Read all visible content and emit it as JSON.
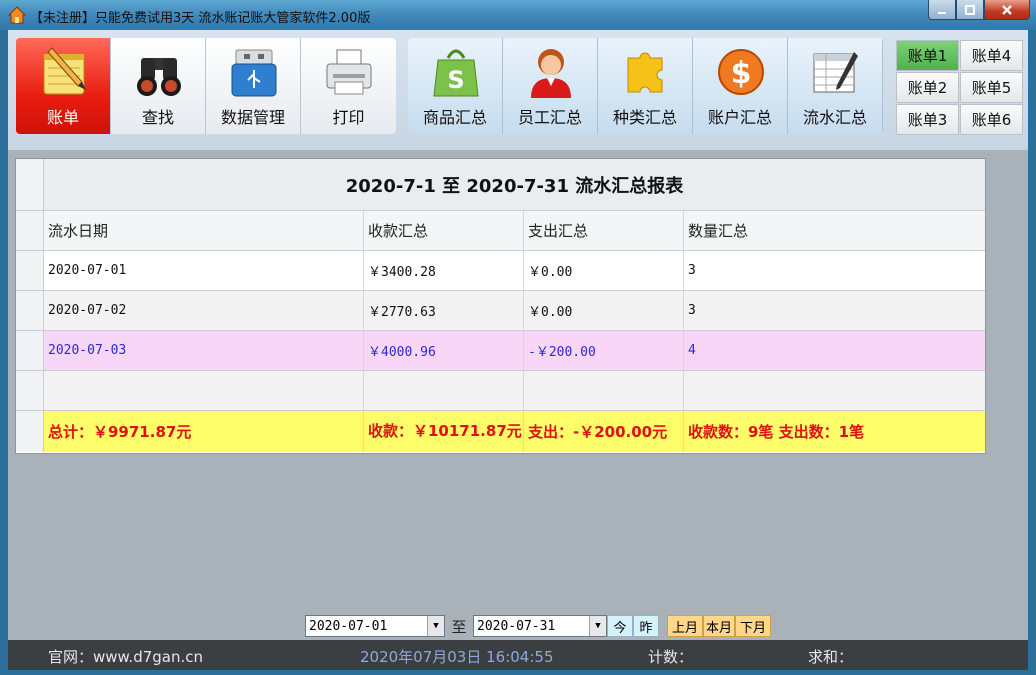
{
  "window": {
    "title": "【未注册】只能免费试用3天  流水账记账大管家软件2.00版"
  },
  "toolbar": {
    "group1": [
      {
        "label": "账单",
        "icon": "notepad-pencil-icon",
        "active": true
      },
      {
        "label": "查找",
        "icon": "binoculars-icon",
        "active": false
      },
      {
        "label": "数据管理",
        "icon": "usb-drive-icon",
        "active": false
      },
      {
        "label": "打印",
        "icon": "printer-icon",
        "active": false
      }
    ],
    "group2": [
      {
        "label": "商品汇总",
        "icon": "shopping-bag-icon"
      },
      {
        "label": "员工汇总",
        "icon": "person-icon"
      },
      {
        "label": "种类汇总",
        "icon": "puzzle-piece-icon"
      },
      {
        "label": "账户汇总",
        "icon": "dollar-coin-icon"
      },
      {
        "label": "流水汇总",
        "icon": "spreadsheet-pen-icon"
      }
    ],
    "bills": [
      {
        "label": "账单1",
        "active": true
      },
      {
        "label": "账单4",
        "active": false
      },
      {
        "label": "账单2",
        "active": false
      },
      {
        "label": "账单5",
        "active": false
      },
      {
        "label": "账单3",
        "active": false
      },
      {
        "label": "账单6",
        "active": false
      }
    ]
  },
  "report": {
    "title": "2020-7-1  至  2020-7-31  流水汇总报表",
    "columns": [
      "流水日期",
      "收款汇总",
      "支出汇总",
      "数量汇总"
    ],
    "rows": [
      [
        "2020-07-01",
        "￥3400.28",
        "￥0.00",
        "3"
      ],
      [
        "2020-07-02",
        "￥2770.63",
        "￥0.00",
        "3"
      ],
      [
        "2020-07-03",
        "￥4000.96",
        "-￥200.00",
        "4"
      ],
      [
        "",
        "",
        "",
        ""
      ]
    ],
    "totals": [
      "总计：￥9971.87元",
      "收款：￥10171.87元",
      "支出：-￥200.00元",
      "收款数：9笔   支出数：1笔"
    ]
  },
  "datebar": {
    "from": "2020-07-01",
    "sep": "至",
    "to": "2020-07-31",
    "today_label": "今",
    "yesterday_label": "昨",
    "last_month_label": "上月",
    "this_month_label": "本月",
    "next_month_label": "下月"
  },
  "status": {
    "website": "官网：www.d7gan.cn",
    "datetime": "2020年07月03日  16:04:55",
    "count_label": "计数：",
    "sum_label": "求和："
  }
}
